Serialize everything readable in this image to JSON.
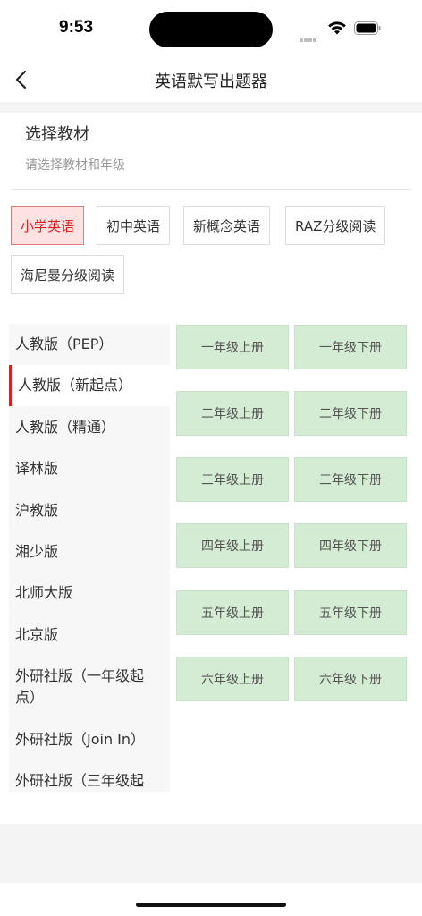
{
  "status": {
    "time": "9:53"
  },
  "nav": {
    "title": "英语默写出题器"
  },
  "section": {
    "title": "选择教材",
    "subtitle": "请选择教材和年级"
  },
  "categories": [
    {
      "label": "小学英语",
      "active": true
    },
    {
      "label": "初中英语",
      "active": false
    },
    {
      "label": "新概念英语",
      "active": false
    },
    {
      "label": "RAZ分级阅读",
      "active": false
    },
    {
      "label": "海尼曼分级阅读",
      "active": false
    }
  ],
  "publishers": [
    {
      "label": "人教版（PEP）"
    },
    {
      "label": "人教版（新起点）",
      "active": true
    },
    {
      "label": "人教版（精通）"
    },
    {
      "label": "译林版"
    },
    {
      "label": "沪教版"
    },
    {
      "label": "湘少版"
    },
    {
      "label": "北师大版"
    },
    {
      "label": "北京版"
    },
    {
      "label": "外研社版（一年级起点）"
    },
    {
      "label": "外研社版（Join In）"
    },
    {
      "label": "外研社版（三年级起"
    }
  ],
  "grades": [
    "一年级上册",
    "一年级下册",
    "二年级上册",
    "二年级下册",
    "三年级上册",
    "三年级下册",
    "四年级上册",
    "四年级下册",
    "五年级上册",
    "五年级下册",
    "六年级上册",
    "六年级下册"
  ]
}
